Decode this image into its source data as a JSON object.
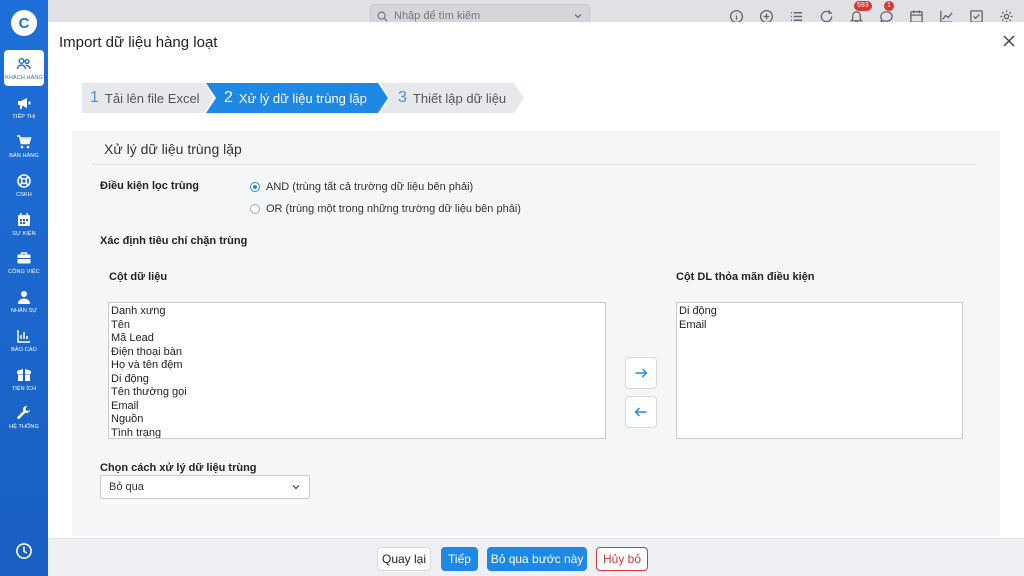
{
  "sidebar": {
    "items": [
      {
        "label": "KHÁCH HÀNG",
        "icon": "users-icon",
        "active": true
      },
      {
        "label": "TIẾP THỊ",
        "icon": "megaphone-icon"
      },
      {
        "label": "BÁN HÀNG",
        "icon": "cart-icon"
      },
      {
        "label": "CSKH",
        "icon": "lifebuoy-icon"
      },
      {
        "label": "SỰ KIỆN",
        "icon": "calendar-icon"
      },
      {
        "label": "CÔNG VIỆC",
        "icon": "briefcase-icon"
      },
      {
        "label": "NHÂN SỰ",
        "icon": "person-icon"
      },
      {
        "label": "BÁO CÁO",
        "icon": "report-icon"
      },
      {
        "label": "TIỆN ÍCH",
        "icon": "box-icon"
      },
      {
        "label": "HỆ THỐNG",
        "icon": "wrench-icon"
      }
    ]
  },
  "topbar": {
    "search_placeholder": "Nhập để tìm kiếm",
    "notif_count": "693",
    "chat_count": "1"
  },
  "modal": {
    "title": "Import dữ liệu hàng loạt",
    "steps": [
      {
        "num": "1",
        "label": "Tải lên file Excel"
      },
      {
        "num": "2",
        "label": "Xử lý dữ liệu trùng lặp"
      },
      {
        "num": "3",
        "label": "Thiết lập dữ liệu"
      }
    ],
    "section_title": "Xử lý dữ liệu trùng lặp",
    "filter_label": "Điều kiện lọc trùng",
    "filter_options": [
      {
        "label": "AND (trùng tất cả trường dữ liệu bên phải)",
        "checked": true
      },
      {
        "label": "OR (trùng một trong những trường dữ liệu bên phải)",
        "checked": false
      }
    ],
    "criteria_label": "Xác định tiêu chí chặn trùng",
    "left_list_label": "Cột dữ liệu",
    "left_list": [
      "Danh xưng",
      "Tên",
      "Mã Lead",
      "Điện thoại bàn",
      "Họ và tên đệm",
      "Di động",
      "Tên thường gọi",
      "Email",
      "Nguồn",
      "Tình trạng"
    ],
    "right_list_label": "Cột DL thỏa mãn điều kiện",
    "right_list": [
      "Di động",
      "Email"
    ],
    "handling_label": "Chọn cách xử lý dữ liệu trùng",
    "handling_value": "Bỏ qua"
  },
  "footer": {
    "back": "Quay lại",
    "next": "Tiếp",
    "skip": "Bỏ qua bước này",
    "cancel": "Hủy bỏ"
  }
}
